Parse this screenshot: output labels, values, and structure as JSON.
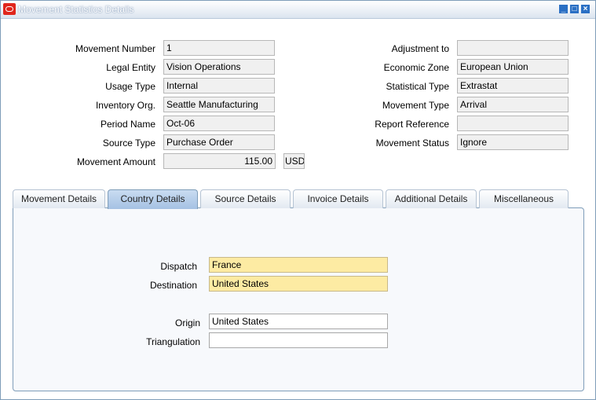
{
  "window": {
    "title": "Movement Statistics Details"
  },
  "header_left": [
    {
      "label": "Movement Number",
      "value": "1"
    },
    {
      "label": "Legal Entity",
      "value": "Vision Operations"
    },
    {
      "label": "Usage Type",
      "value": "Internal"
    },
    {
      "label": "Inventory Org.",
      "value": "Seattle Manufacturing"
    },
    {
      "label": "Period Name",
      "value": "Oct-06"
    },
    {
      "label": "Source Type",
      "value": "Purchase Order"
    },
    {
      "label": "Movement Amount",
      "value": "115.00",
      "currency": "USD"
    }
  ],
  "header_right": [
    {
      "label": "Adjustment to",
      "value": ""
    },
    {
      "label": "Economic Zone",
      "value": "European Union"
    },
    {
      "label": "Statistical Type",
      "value": "Extrastat"
    },
    {
      "label": "Movement Type",
      "value": "Arrival"
    },
    {
      "label": "Report Reference",
      "value": ""
    },
    {
      "label": "Movement Status",
      "value": "Ignore"
    }
  ],
  "tabs": [
    {
      "label": "Movement Details"
    },
    {
      "label": "Country Details",
      "active": true
    },
    {
      "label": "Source Details"
    },
    {
      "label": "Invoice Details"
    },
    {
      "label": "Additional Details"
    },
    {
      "label": "Miscellaneous"
    }
  ],
  "country_details": {
    "dispatch": {
      "label": "Dispatch",
      "value": "France"
    },
    "destination": {
      "label": "Destination",
      "value": "United States"
    },
    "origin": {
      "label": "Origin",
      "value": "United States"
    },
    "triangulation": {
      "label": "Triangulation",
      "value": ""
    }
  },
  "colors": {
    "required_field": "#fdeba3",
    "readonly_field": "#f0f0f0",
    "active_tab": "#a5c1e3"
  }
}
